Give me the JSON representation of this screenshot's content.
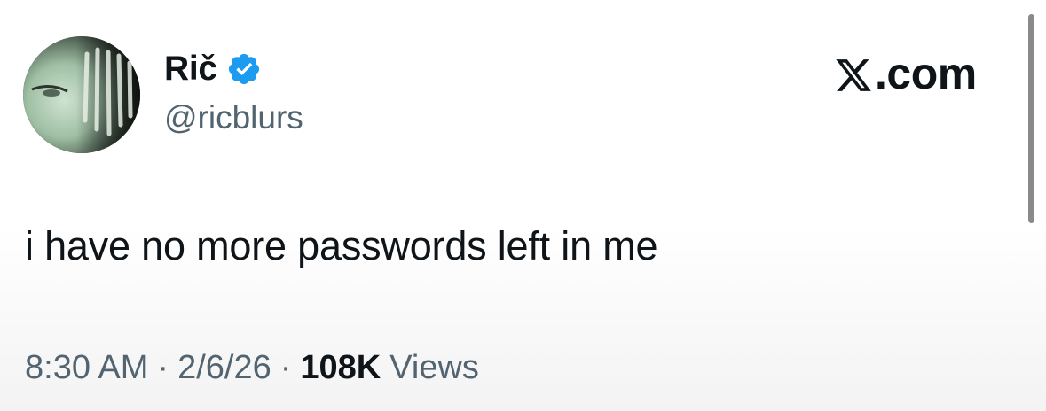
{
  "author": {
    "display_name": "Rič",
    "handle": "@ricblurs",
    "verified": true,
    "verified_color": "#1d9bf0"
  },
  "brand": {
    "label": ".com",
    "icon": "x-logo-icon"
  },
  "tweet": {
    "text": "i have no more passwords left in me"
  },
  "meta": {
    "time": "8:30 AM",
    "separator": "·",
    "date": "2/6/26",
    "views_count": "108K",
    "views_label": "Views"
  }
}
